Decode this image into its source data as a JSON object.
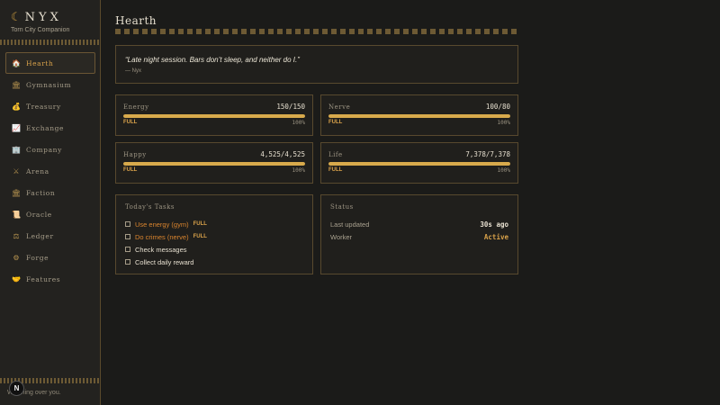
{
  "sidebar": {
    "brand": "NYX",
    "subtitle": "Torn City Companion",
    "footer": "Watching over you.",
    "badge": "N",
    "items": [
      {
        "label": "Hearth",
        "icon": "home-icon",
        "glyph": "🏠"
      },
      {
        "label": "Gymnasium",
        "icon": "gym-icon",
        "glyph": "🏛"
      },
      {
        "label": "Treasury",
        "icon": "money-bag-icon",
        "glyph": "💰"
      },
      {
        "label": "Exchange",
        "icon": "chart-icon",
        "glyph": "📈"
      },
      {
        "label": "Company",
        "icon": "building-icon",
        "glyph": "🏢"
      },
      {
        "label": "Arena",
        "icon": "swords-icon",
        "glyph": "⚔"
      },
      {
        "label": "Faction",
        "icon": "temple-icon",
        "glyph": "🏛"
      },
      {
        "label": "Oracle",
        "icon": "scroll-icon",
        "glyph": "📜"
      },
      {
        "label": "Ledger",
        "icon": "scales-icon",
        "glyph": "⚖"
      },
      {
        "label": "Forge",
        "icon": "gear-icon",
        "glyph": "⚙"
      },
      {
        "label": "Features",
        "icon": "handshake-icon",
        "glyph": "🤝"
      }
    ]
  },
  "main": {
    "title": "Hearth",
    "quote": {
      "text": "“Late night session. Bars don’t sleep, and neither do I.”",
      "author": "— Nyx"
    },
    "stats": [
      {
        "name": "Energy",
        "value": "150/150",
        "fill": 1.0,
        "state": "FULL",
        "pct": "100%"
      },
      {
        "name": "Nerve",
        "value": "100/80",
        "fill": 1.0,
        "state": "FULL",
        "pct": "100%"
      },
      {
        "name": "Happy",
        "value": "4,525/4,525",
        "fill": 1.0,
        "state": "FULL",
        "pct": "100%"
      },
      {
        "name": "Life",
        "value": "7,378/7,378",
        "fill": 1.0,
        "state": "FULL",
        "pct": "100%"
      }
    ],
    "tasks": {
      "title": "Today's Tasks",
      "items": [
        {
          "label": "Use energy (gym)",
          "tag": "FULL"
        },
        {
          "label": "Do crimes (nerve)",
          "tag": "FULL"
        },
        {
          "label": "Check messages",
          "tag": ""
        },
        {
          "label": "Collect daily reward",
          "tag": ""
        }
      ]
    },
    "status": {
      "title": "Status",
      "rows": [
        {
          "key": "Last updated",
          "value": "30s ago"
        },
        {
          "key": "Worker",
          "value": "Active"
        }
      ]
    }
  },
  "colors": {
    "accent": "#d9a24a",
    "bar": "#d8aa4c",
    "warn": "#d9842e",
    "border": "#58492e"
  }
}
